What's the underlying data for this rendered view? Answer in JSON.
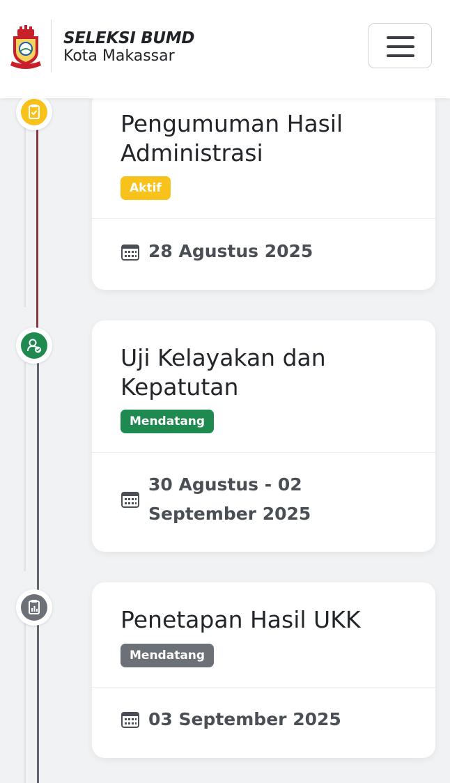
{
  "header": {
    "brand_title": "SELEKSI BUMD",
    "brand_subtitle": "Kota Makassar",
    "logo_icon": "makassar-city-emblem",
    "menu_icon": "hamburger-menu-icon"
  },
  "timeline": [
    {
      "title": "Pengumuman Hasil Administrasi",
      "status": "Aktif",
      "status_color": "#f8c21a",
      "date": "28 Agustus 2025",
      "icon": "clipboard-check-icon",
      "icon_color": "#f8c21a"
    },
    {
      "title": "Uji Kelayakan dan Kepatutan",
      "status": "Mendatang",
      "status_color": "#1f8a4f",
      "date": "30 Agustus - 02 September 2025",
      "icon": "user-check-icon",
      "icon_color": "#1f8a4f"
    },
    {
      "title": "Penetapan Hasil UKK",
      "status": "Mendatang",
      "status_color": "#6b7177",
      "date": "03 September 2025",
      "icon": "clipboard-chart-icon",
      "icon_color": "#6b7177"
    }
  ],
  "colors": {
    "active_line": "#8b3a3f",
    "inactive_line": "#5f666d",
    "background": "#f1f2f4"
  }
}
